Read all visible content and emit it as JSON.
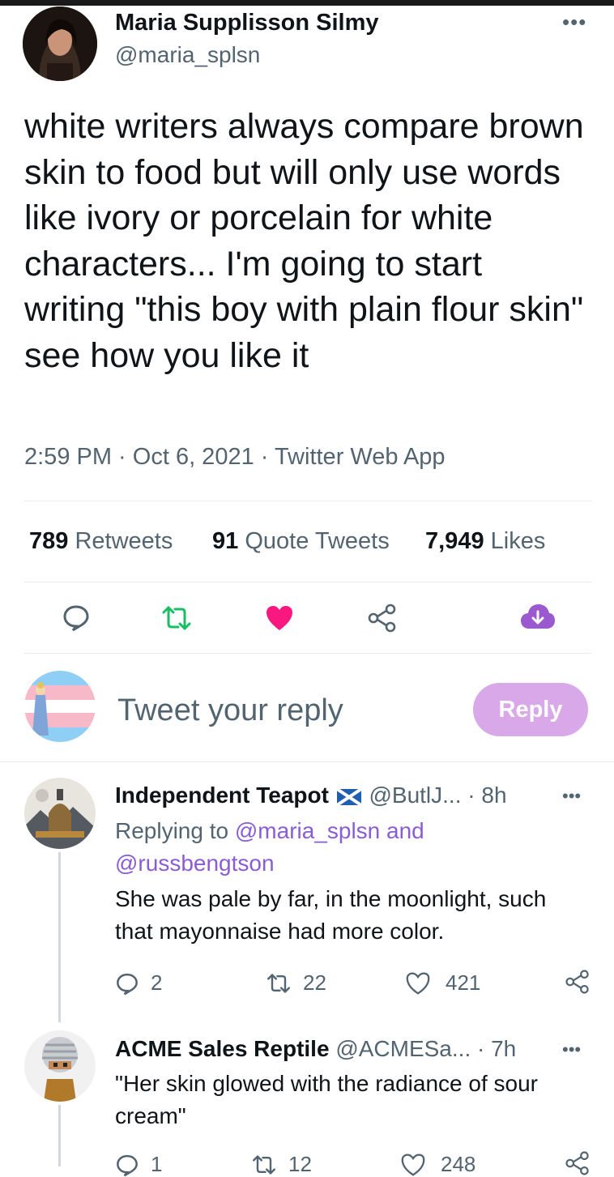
{
  "main_tweet": {
    "display_name": "Maria Supplisson Silmy",
    "handle": "@maria_splsn",
    "text": "white writers always compare brown skin to food but will only use words like ivory or porcelain for white characters... I'm going to start writing \"this boy with plain flour skin\" see how you like it",
    "meta": "2:59 PM · Oct 6, 2021 · Twitter Web App",
    "stats": [
      {
        "count": "789",
        "label": "Retweets"
      },
      {
        "count": "91",
        "label": "Quote Tweets"
      },
      {
        "count": "7,949",
        "label": "Likes"
      }
    ],
    "more_icon": "more-dots-icon"
  },
  "actions": {
    "icons": [
      "comment-icon",
      "retweet-icon",
      "heart-filled-icon",
      "share-icon",
      "download-cloud-icon"
    ],
    "retweet_color": "#17bf63",
    "like_color": "#f91880",
    "download_color": "#9b59d0"
  },
  "reply_compose": {
    "placeholder": "Tweet your reply",
    "button_label": "Reply",
    "button_color": "#d9a8e8"
  },
  "replies": [
    {
      "display_name": "Independent Teapot",
      "flag": "scotland-flag-icon",
      "handle": "@ButlJ...",
      "time": "· 8h",
      "replying_prefix": "Replying to",
      "replying_to_1": "@maria_splsn and",
      "replying_to_2": "@russbengtson",
      "text_line1": "She was pale by far, in the moonlight, such",
      "text_line2": "that mayonnaise had more color.",
      "replies": "2",
      "retweets": "22",
      "likes": "421"
    },
    {
      "display_name": "ACME Sales Reptile",
      "handle": "@ACMESa...",
      "time": "· 7h",
      "text_line1": "\"Her skin glowed with the radiance of sour",
      "text_line2": "cream\"",
      "replies": "1",
      "retweets": "12",
      "likes": "248"
    }
  ],
  "colors": {
    "text": "#0f1419",
    "muted": "#536471",
    "link": "#8a5cd6"
  }
}
